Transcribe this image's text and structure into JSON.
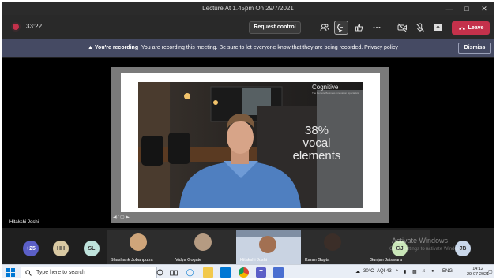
{
  "window": {
    "title": "Lecture At 1.45pm On 29/7/2021",
    "controls": [
      "minimize-icon",
      "maximize-icon",
      "close-icon"
    ]
  },
  "toolbar": {
    "timer": "33:22",
    "request_control": "Request control",
    "leave": "Leave",
    "icons": [
      "people-icon",
      "chat-icon",
      "reactions-icon",
      "more-icon",
      "camera-off-icon",
      "mic-off-icon",
      "share-icon"
    ]
  },
  "banner": {
    "heading": "You're recording",
    "text": "You are recording this meeting. Be sure to let everyone know that they are being recorded.",
    "link": "Privacy policy",
    "dismiss": "Dismiss"
  },
  "stage": {
    "presenter": "Hitakshi Joshi",
    "slide": {
      "brand": "Cognitive",
      "brand_sub": "The Remote Business Innovation Specialists",
      "stat_line1": "38%",
      "stat_line2": "vocal",
      "stat_line3": "elements"
    }
  },
  "participants": {
    "overflow": "+25",
    "initials": [
      {
        "text": "HH",
        "color": "#d9c9a3"
      },
      {
        "text": "SL",
        "color": "#bfe3dc"
      },
      {
        "text": "GJ",
        "color": "#c9e6b8"
      },
      {
        "text": "JB",
        "color": "#c9d7ea"
      }
    ],
    "tiles": [
      {
        "name": "Shashank Jobanputra"
      },
      {
        "name": "Vidya Gogate"
      },
      {
        "name": "Hitakshi Joshi"
      },
      {
        "name": "Karan Gupta"
      },
      {
        "name": "Gunjan Jaiswara"
      }
    ],
    "watermark_title": "Activate Windows",
    "watermark_sub": "Go to Settings to activate Windows."
  },
  "taskbar": {
    "search_placeholder": "Type here to search",
    "weather": "30°C",
    "aqi": "AQI 43",
    "language": "ENG",
    "time": "14:12",
    "date": "29-07-2021"
  },
  "colors": {
    "leave_red": "#c4314b",
    "banner": "#454a63",
    "teams_purple": "#5b5fc7"
  }
}
